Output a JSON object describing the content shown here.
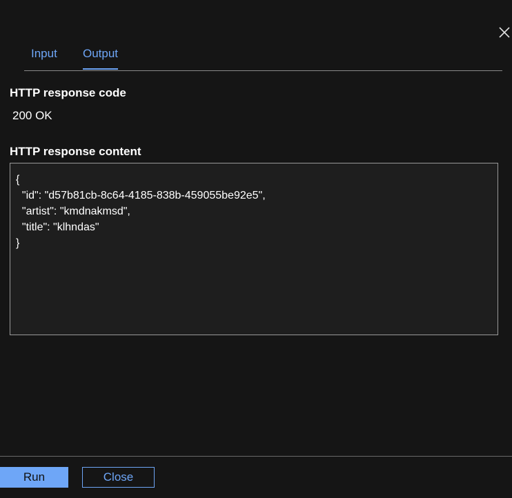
{
  "dialog": {
    "close_icon": "close-icon"
  },
  "tabs": [
    {
      "label": "Input",
      "selected": false
    },
    {
      "label": "Output",
      "selected": true
    }
  ],
  "response": {
    "code_label": "HTTP response code",
    "code_value": "200 OK",
    "content_label": "HTTP response content",
    "content_value": "{\n  \"id\": \"d57b81cb-8c64-4185-838b-459055be92e5\",\n  \"artist\": \"kmdnakmsd\",\n  \"title\": \"klhndas\"\n}"
  },
  "footer": {
    "run_label": "Run",
    "close_label": "Close"
  },
  "colors": {
    "accent": "#6ea6f7",
    "background": "#151515",
    "content_background": "#1e1e1e"
  }
}
